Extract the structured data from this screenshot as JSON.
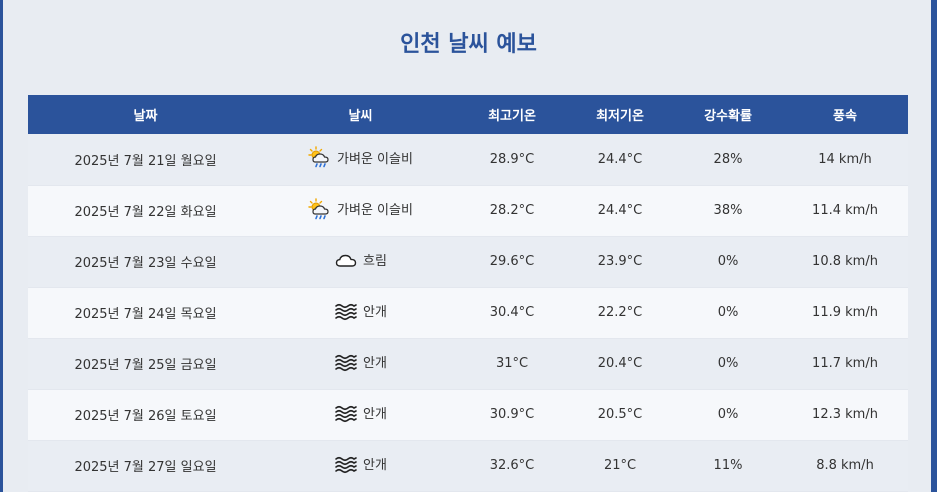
{
  "title": "인천 날씨 예보",
  "columns": [
    "날짜",
    "날씨",
    "최고기온",
    "최저기온",
    "강수확률",
    "풍속"
  ],
  "rows": [
    {
      "date": "2025년 7월 21일 월요일",
      "weather": "가벼운 이슬비",
      "icon": "sun-cloud-drizzle-icon",
      "high": "28.9°C",
      "low": "24.4°C",
      "precip": "28%",
      "wind": "14 km/h"
    },
    {
      "date": "2025년 7월 22일 화요일",
      "weather": "가벼운 이슬비",
      "icon": "sun-cloud-drizzle-icon",
      "high": "28.2°C",
      "low": "24.4°C",
      "precip": "38%",
      "wind": "11.4 km/h"
    },
    {
      "date": "2025년 7월 23일 수요일",
      "weather": "흐림",
      "icon": "cloud-icon",
      "high": "29.6°C",
      "low": "23.9°C",
      "precip": "0%",
      "wind": "10.8 km/h"
    },
    {
      "date": "2025년 7월 24일 목요일",
      "weather": "안개",
      "icon": "fog-icon",
      "high": "30.4°C",
      "low": "22.2°C",
      "precip": "0%",
      "wind": "11.9 km/h"
    },
    {
      "date": "2025년 7월 25일 금요일",
      "weather": "안개",
      "icon": "fog-icon",
      "high": "31°C",
      "low": "20.4°C",
      "precip": "0%",
      "wind": "11.7 km/h"
    },
    {
      "date": "2025년 7월 26일 토요일",
      "weather": "안개",
      "icon": "fog-icon",
      "high": "30.9°C",
      "low": "20.5°C",
      "precip": "0%",
      "wind": "12.3 km/h"
    },
    {
      "date": "2025년 7월 27일 일요일",
      "weather": "안개",
      "icon": "fog-icon",
      "high": "32.6°C",
      "low": "21°C",
      "precip": "11%",
      "wind": "8.8 km/h"
    }
  ],
  "colors": {
    "accent": "#2b539b",
    "background": "#e8ecf2",
    "row_alt": "#f6f8fb"
  }
}
